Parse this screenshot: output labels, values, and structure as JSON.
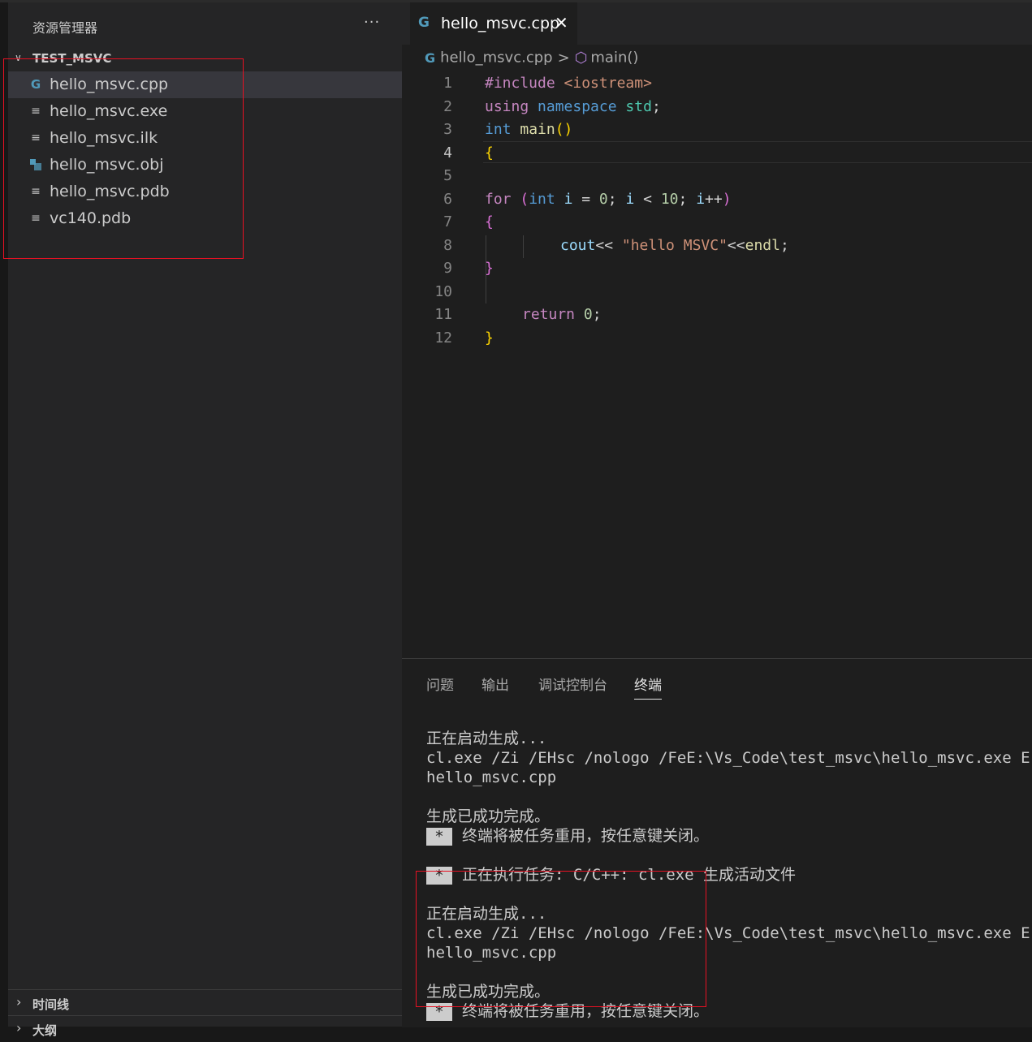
{
  "sidebar": {
    "title": "资源管理器",
    "more": "···",
    "folder": "TEST_MSVC",
    "files": [
      {
        "name": "hello_msvc.cpp",
        "icon": "cpp-file-icon"
      },
      {
        "name": "hello_msvc.exe",
        "icon": "file-lines-icon"
      },
      {
        "name": "hello_msvc.ilk",
        "icon": "file-lines-icon"
      },
      {
        "name": "hello_msvc.obj",
        "icon": "object-file-icon"
      },
      {
        "name": "hello_msvc.pdb",
        "icon": "file-lines-icon"
      },
      {
        "name": "vc140.pdb",
        "icon": "file-lines-icon"
      }
    ],
    "sections": [
      "时间线",
      "大纲"
    ]
  },
  "editor": {
    "tab_label": "hello_msvc.cpp",
    "breadcrumb": {
      "file": "hello_msvc.cpp",
      "symbol": "main()"
    },
    "current_line": 4,
    "lines": [
      {
        "n": "1"
      },
      {
        "n": "2"
      },
      {
        "n": "3"
      },
      {
        "n": "4"
      },
      {
        "n": "5"
      },
      {
        "n": "6"
      },
      {
        "n": "7"
      },
      {
        "n": "8"
      },
      {
        "n": "9"
      },
      {
        "n": "10"
      },
      {
        "n": "11"
      },
      {
        "n": "12"
      }
    ],
    "tokens": {
      "l1": [
        "#include",
        " ",
        "<iostream>"
      ],
      "l2": [
        "using",
        " ",
        "namespace",
        " ",
        "std",
        ";"
      ],
      "l3": [
        "int",
        " ",
        "main",
        "()"
      ],
      "l4": [
        "{"
      ],
      "l6": [
        "for",
        " ",
        "(",
        "int",
        " ",
        "i",
        " = ",
        "0",
        "; ",
        "i",
        " < ",
        "10",
        "; ",
        "i",
        "++",
        ")"
      ],
      "l7": [
        "{"
      ],
      "l8": [
        "cout",
        "<< ",
        "\"hello MSVC\"",
        "<<",
        "endl",
        ";"
      ],
      "l9": [
        "}"
      ],
      "l11": [
        "return",
        " ",
        "0",
        ";"
      ],
      "l12": [
        "}"
      ]
    }
  },
  "panel": {
    "tabs": [
      "问题",
      "输出",
      "调试控制台",
      "终端"
    ],
    "active_tab": "终端",
    "star": "*",
    "terminal": [
      "正在启动生成...",
      "cl.exe /Zi /EHsc /nologo /FeE:\\Vs_Code\\test_msvc\\hello_msvc.exe E:\\Vs_Code\\test_msvc\\hello_msvc.cpp",
      "hello_msvc.cpp",
      "",
      "生成已成功完成。",
      "终端将被任务重用，按任意键关闭。",
      "",
      "正在执行任务: C/C++: cl.exe 生成活动文件",
      "",
      "正在启动生成...",
      "cl.exe /Zi /EHsc /nologo /FeE:\\Vs_Code\\test_msvc\\hello_msvc.exe E:\\Vs_Code\\test_msvc\\hello_msvc.cpp",
      "hello_msvc.cpp",
      "",
      "生成已成功完成。",
      "终端将被任务重用，按任意键关闭。"
    ]
  },
  "colors": {
    "highlight_box": "#e81123",
    "accent": "#519aba"
  }
}
